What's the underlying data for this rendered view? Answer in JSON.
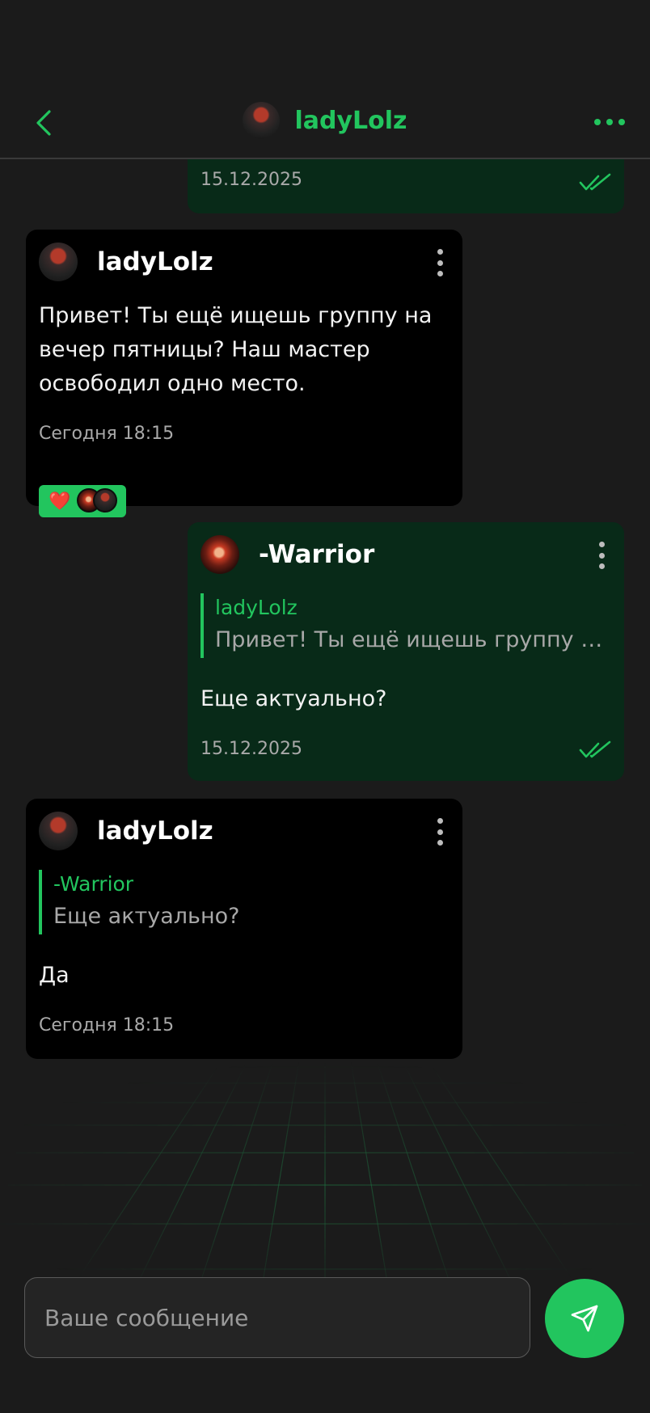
{
  "header": {
    "title": "ladyLolz",
    "accent_color": "#22c55e",
    "back_icon": "chevron-left-icon",
    "more_icon": "more-horizontal-icon"
  },
  "messages": [
    {
      "direction": "out",
      "time": "15.12.2025",
      "status_icon": "double-check-icon"
    },
    {
      "direction": "in",
      "author": "ladyLolz",
      "text": "Привет! Ты ещё ищешь группу на вечер пятницы? Наш мастер освободил одно место.",
      "time": "Сегодня 18:15",
      "reaction": {
        "emoji": "❤️"
      }
    },
    {
      "direction": "out",
      "author": "-Warrior",
      "quote": {
        "author": "ladyLolz",
        "text": "Привет! Ты ещё ищешь группу на вечер пятницы? Наш мастер освободил одно место."
      },
      "text": "Еще актуально?",
      "time": "15.12.2025",
      "status_icon": "double-check-icon"
    },
    {
      "direction": "in",
      "author": "ladyLolz",
      "quote": {
        "author": "-Warrior",
        "text": "Еще актуально?"
      },
      "text": "Да",
      "time": "Сегодня 18:15"
    }
  ],
  "composer": {
    "placeholder": "Ваше сообщение",
    "send_icon": "send-icon"
  }
}
